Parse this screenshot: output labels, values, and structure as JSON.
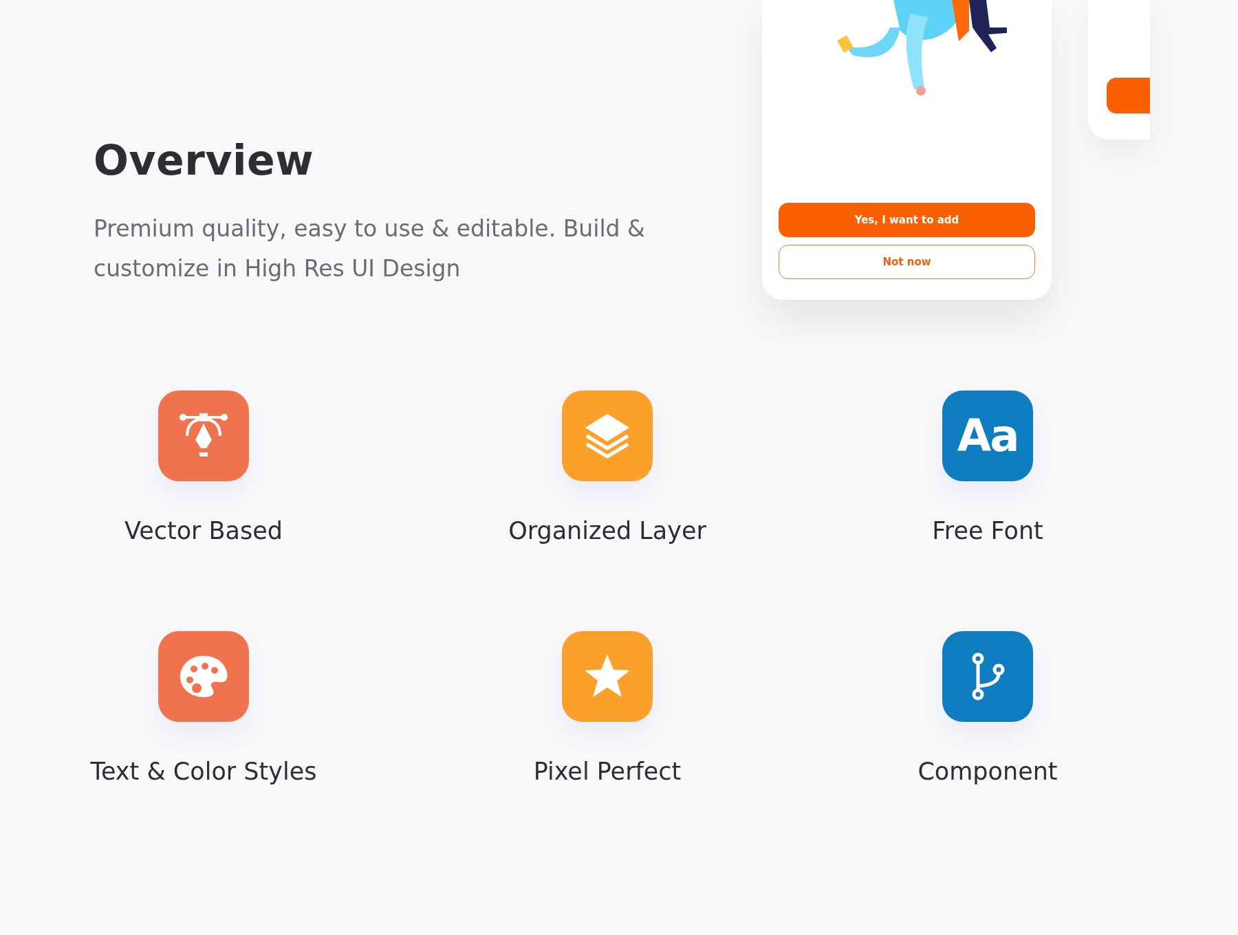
{
  "overview": {
    "title": "Overview",
    "description": "Premium quality, easy to use & editable. Build & customize in High Res UI Design"
  },
  "phone_card": {
    "buttons": [
      {
        "label": "Yes, I want to add",
        "kind": "primary"
      },
      {
        "label": "Not now",
        "kind": "outline"
      }
    ]
  },
  "features": [
    {
      "label": "Vector Based",
      "kind": "pen",
      "color": "#f07350"
    },
    {
      "label": "Organized Layer",
      "kind": "layers",
      "color": "#fca02c"
    },
    {
      "label": "Free Font",
      "kind": "text",
      "glyph": "Aa",
      "color": "#0d7dbf"
    },
    {
      "label": "Text & Color Styles",
      "kind": "palette",
      "color": "#f07350"
    },
    {
      "label": "Pixel Perfect",
      "kind": "star",
      "color": "#fca02c"
    },
    {
      "label": "Component",
      "kind": "branch",
      "color": "#0d7dbf"
    }
  ]
}
